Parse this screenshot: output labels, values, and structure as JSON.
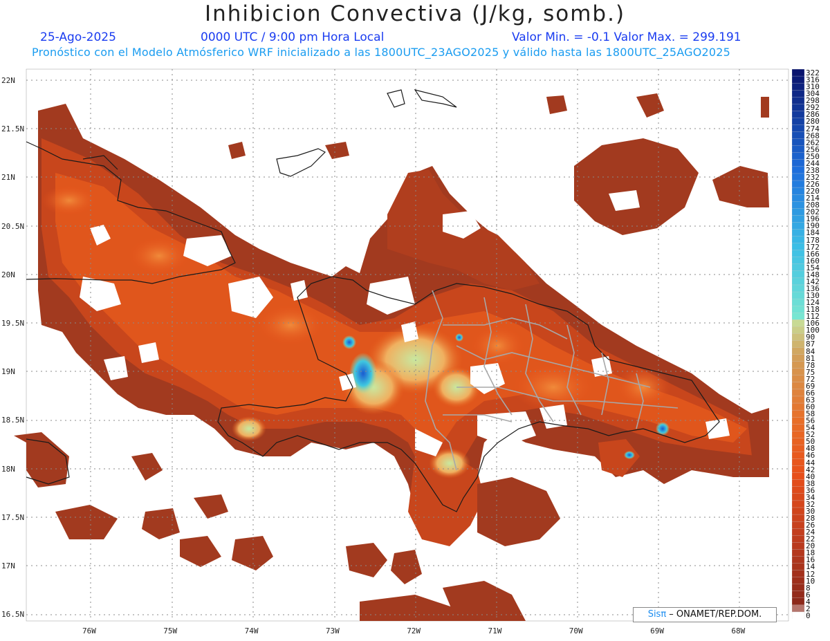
{
  "header": {
    "title": "Inhibicion Convectiva (J/kg, somb.)",
    "date": "25-Ago-2025",
    "time": "0000 UTC / 9:00 pm Hora Local",
    "minmax": "Valor Min. = -0.1  Valor Max. = 299.191",
    "model_line": "Pronóstico con el Modelo Atmósferico WRF inicializado a las 1800UTC_23AGO2025 y válido hasta las  1800UTC_25AGO2025"
  },
  "map": {
    "lat_labels": [
      "22N",
      "21.5N",
      "21N",
      "20.5N",
      "20N",
      "19.5N",
      "19N",
      "18.5N",
      "18N",
      "17.5N",
      "17N",
      "16.5N"
    ],
    "lon_labels": [
      "76W",
      "75W",
      "74W",
      "73W",
      "72W",
      "71W",
      "70W",
      "69W",
      "68W"
    ],
    "field": "Inhibicion Convectiva",
    "units": "J/kg",
    "colors": {
      "low": "#8b2a1a",
      "mid": "#e8501a",
      "high": "#1a6ad8",
      "border": "#1a1a1a",
      "province": "#9a9a9a"
    }
  },
  "colorbar": {
    "labels": [
      "322",
      "316",
      "310",
      "304",
      "298",
      "292",
      "286",
      "280",
      "274",
      "268",
      "262",
      "256",
      "250",
      "244",
      "238",
      "232",
      "226",
      "220",
      "214",
      "208",
      "202",
      "196",
      "190",
      "184",
      "178",
      "172",
      "166",
      "160",
      "154",
      "148",
      "142",
      "136",
      "130",
      "124",
      "118",
      "112",
      "106",
      "100",
      "90",
      "87",
      "84",
      "81",
      "78",
      "75",
      "72",
      "69",
      "66",
      "63",
      "60",
      "58",
      "56",
      "54",
      "52",
      "50",
      "48",
      "46",
      "44",
      "42",
      "40",
      "38",
      "36",
      "34",
      "32",
      "30",
      "28",
      "26",
      "24",
      "22",
      "20",
      "18",
      "16",
      "14",
      "12",
      "10",
      "8",
      "6",
      "4",
      "2",
      "0"
    ]
  },
  "credit": {
    "sis": "Sisπ",
    "org": " – ONAMET/REP.DOM."
  }
}
